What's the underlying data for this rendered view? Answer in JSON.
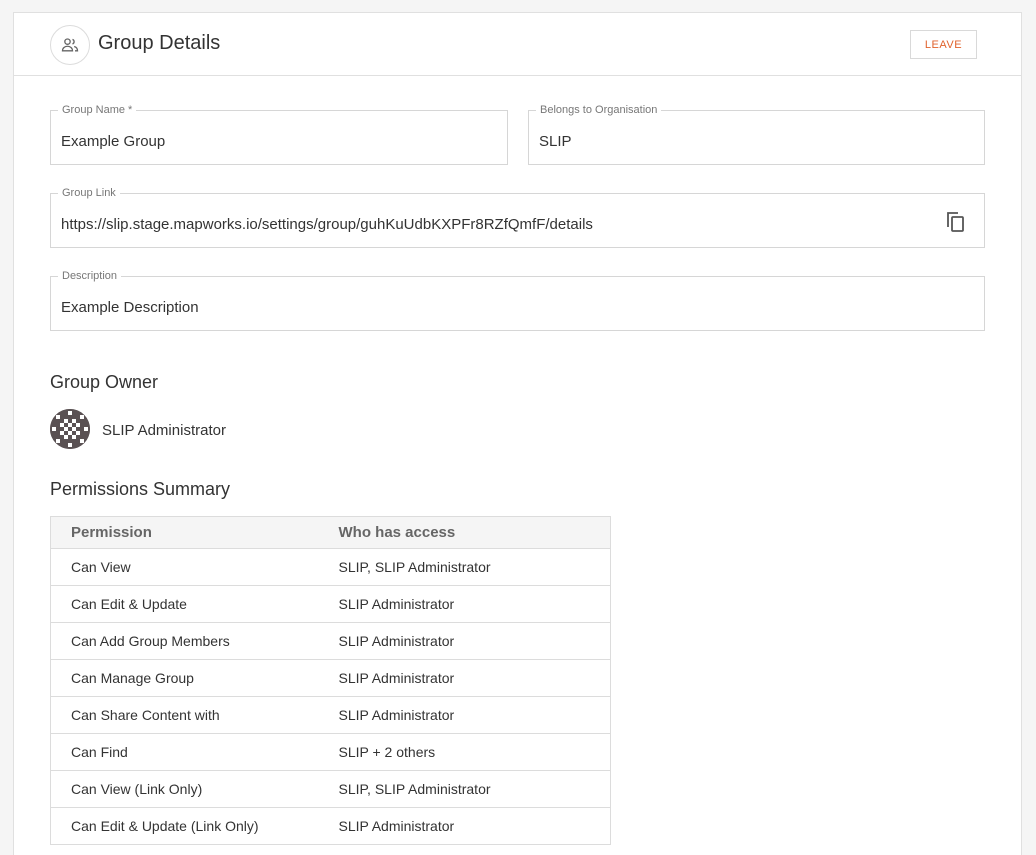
{
  "header": {
    "icon": "group-icon",
    "title": "Group Details",
    "leave_label": "LEAVE"
  },
  "fields": {
    "group_name": {
      "label": "Group Name *",
      "value": "Example Group"
    },
    "organisation": {
      "label": "Belongs to Organisation",
      "value": "SLIP"
    },
    "group_link": {
      "label": "Group Link",
      "value": "https://slip.stage.mapworks.io/settings/group/guhKuUdbKXPFr8RZfQmfF/details",
      "copy_icon": "copy-icon"
    },
    "description": {
      "label": "Description",
      "value": "Example Description"
    }
  },
  "owner": {
    "section_title": "Group Owner",
    "name": "SLIP Administrator"
  },
  "permissions": {
    "section_title": "Permissions Summary",
    "columns": [
      "Permission",
      "Who has access"
    ],
    "rows": [
      {
        "permission": "Can View",
        "access": "SLIP, SLIP Administrator"
      },
      {
        "permission": "Can Edit & Update",
        "access": "SLIP Administrator"
      },
      {
        "permission": "Can Add Group Members",
        "access": "SLIP Administrator"
      },
      {
        "permission": "Can Manage Group",
        "access": "SLIP Administrator"
      },
      {
        "permission": "Can Share Content with",
        "access": "SLIP Administrator"
      },
      {
        "permission": "Can Find",
        "access": "SLIP + 2 others"
      },
      {
        "permission": "Can View (Link Only)",
        "access": "SLIP, SLIP Administrator"
      },
      {
        "permission": "Can Edit & Update (Link Only)",
        "access": "SLIP Administrator"
      }
    ]
  },
  "colors": {
    "accent": "#e0622c",
    "avatar_bg": "#5a5153"
  }
}
